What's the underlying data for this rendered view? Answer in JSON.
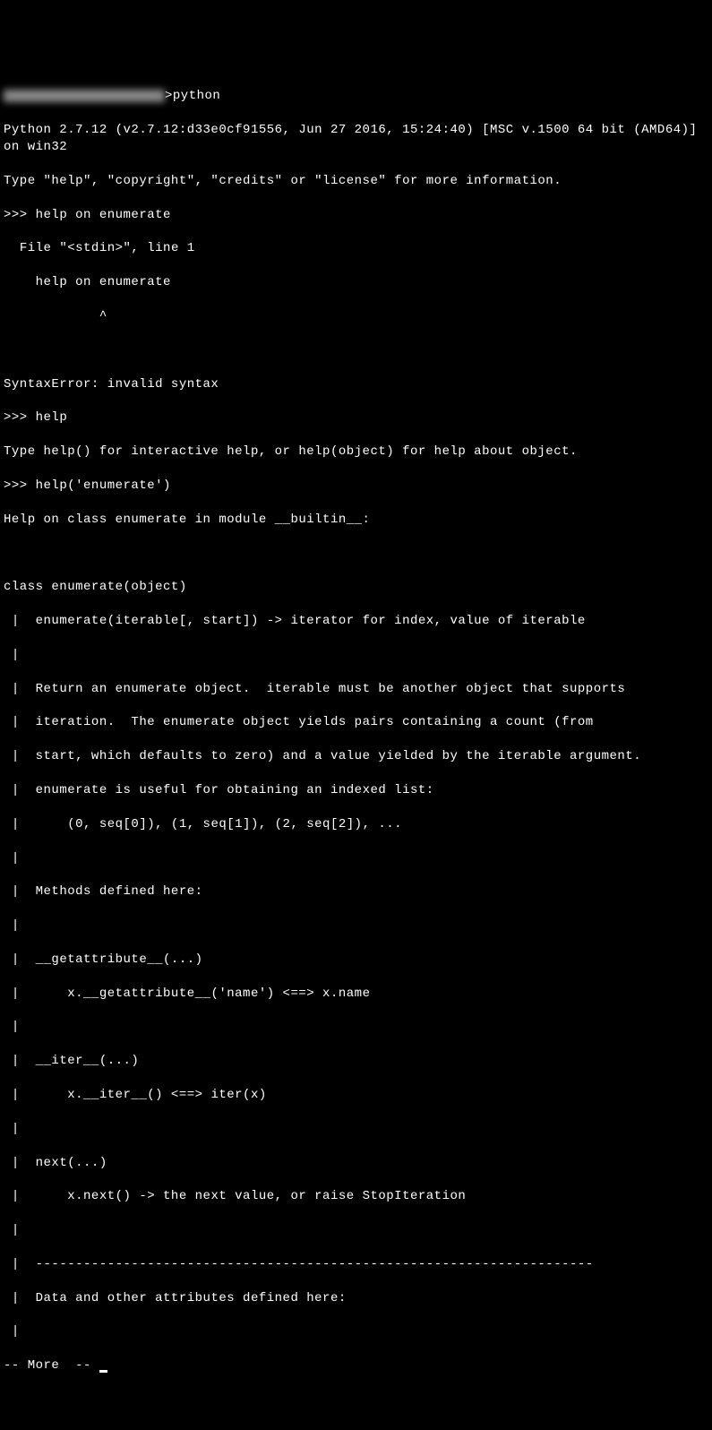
{
  "cmdline": {
    "blurred_path": "████████████",
    "prompt_char": ">",
    "command": "python"
  },
  "python_header": {
    "version_line": "Python 2.7.12 (v2.7.12:d33e0cf91556, Jun 27 2016, 15:24:40) [MSC v.1500 64 bit (AMD64)] on win32",
    "type_help_line": "Type \"help\", \"copyright\", \"credits\" or \"license\" for more information."
  },
  "repl": {
    "prompt1": ">>> ",
    "input1": "help on enumerate",
    "traceback_file": "  File \"<stdin>\", line 1",
    "traceback_echo": "    help on enumerate",
    "traceback_caret": "            ^",
    "syntax_error": "SyntaxError: invalid syntax",
    "input2": "help",
    "help_repr": "Type help() for interactive help, or help(object) for help about object.",
    "input3": "help('enumerate')"
  },
  "help_output": {
    "header": "Help on class enumerate in module __builtin__:",
    "class_line": "class enumerate(object)",
    "sig": " |  enumerate(iterable[, start]) -> iterator for index, value of iterable",
    "blank1": " |  ",
    "desc1": " |  Return an enumerate object.  iterable must be another object that supports",
    "desc2": " |  iteration.  The enumerate object yields pairs containing a count (from",
    "desc3": " |  start, which defaults to zero) and a value yielded by the iterable argument.",
    "desc4": " |  enumerate is useful for obtaining an indexed list:",
    "desc5": " |      (0, seq[0]), (1, seq[1]), (2, seq[2]), ...",
    "blank2": " |  ",
    "methods_header": " |  Methods defined here:",
    "blank3": " |  ",
    "getattr_sig": " |  __getattribute__(...)",
    "getattr_doc": " |      x.__getattribute__('name') <==> x.name",
    "blank4": " |  ",
    "iter_sig": " |  __iter__(...)",
    "iter_doc": " |      x.__iter__() <==> iter(x)",
    "blank5": " |  ",
    "next_sig": " |  next(...)",
    "next_doc": " |      x.next() -> the next value, or raise StopIteration",
    "blank6": " |  ",
    "separator": " |  ----------------------------------------------------------------------",
    "data_header": " |  Data and other attributes defined here:",
    "blank7": " |  "
  },
  "pager": {
    "more": "-- More  -- "
  }
}
